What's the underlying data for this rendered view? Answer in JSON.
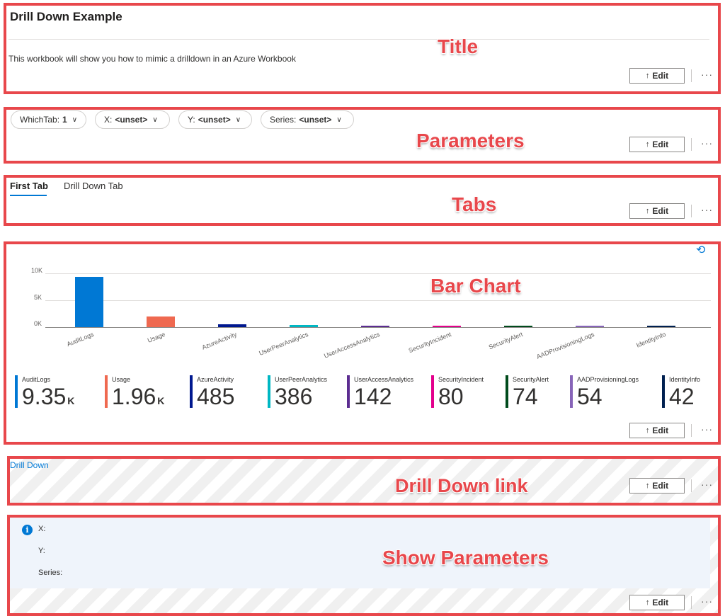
{
  "title_section": {
    "heading": "Drill Down Example",
    "description": "This workbook will show you how to mimic a drilldown in an Azure Workbook",
    "annotation": "Title"
  },
  "parameters": {
    "chips": [
      {
        "label": "WhichTab:",
        "value": "1"
      },
      {
        "label": "X:",
        "value": "<unset>"
      },
      {
        "label": "Y:",
        "value": "<unset>"
      },
      {
        "label": "Series:",
        "value": "<unset>"
      }
    ],
    "annotation": "Parameters"
  },
  "tabs": {
    "items": [
      "First Tab",
      "Drill Down Tab"
    ],
    "active_index": 0,
    "annotation": "Tabs"
  },
  "chart_data": {
    "type": "bar",
    "categories": [
      "AuditLogs",
      "Usage",
      "AzureActivity",
      "UserPeerAnalytics",
      "UserAccessAnalytics",
      "SecurityIncident",
      "SecurityAlert",
      "AADProvisioningLogs",
      "IdentityInfo"
    ],
    "values": [
      9350,
      1960,
      485,
      386,
      142,
      80,
      74,
      54,
      42
    ],
    "colors": [
      "#0078d4",
      "#ef6950",
      "#00188f",
      "#00b7c3",
      "#5c2d91",
      "#e3008c",
      "#004b1c",
      "#8764b8",
      "#002050"
    ],
    "yticks": [
      "10K",
      "5K",
      "0K"
    ],
    "ylim": [
      0,
      10000
    ],
    "grid": true,
    "annotation": "Bar Chart"
  },
  "tiles": [
    {
      "name": "AuditLogs",
      "value": "9.35",
      "unit": "K"
    },
    {
      "name": "Usage",
      "value": "1.96",
      "unit": "K"
    },
    {
      "name": "AzureActivity",
      "value": "485",
      "unit": ""
    },
    {
      "name": "UserPeerAnalytics",
      "value": "386",
      "unit": ""
    },
    {
      "name": "UserAccessAnalytics",
      "value": "142",
      "unit": ""
    },
    {
      "name": "SecurityIncident",
      "value": "80",
      "unit": ""
    },
    {
      "name": "SecurityAlert",
      "value": "74",
      "unit": ""
    },
    {
      "name": "AADProvisioningLogs",
      "value": "54",
      "unit": ""
    },
    {
      "name": "IdentityInfo",
      "value": "42",
      "unit": ""
    }
  ],
  "drill_down": {
    "link": "Drill Down",
    "annotation": "Drill Down link"
  },
  "show_params": {
    "x_label": "X:",
    "y_label": "Y:",
    "series_label": "Series:",
    "annotation": "Show Parameters"
  },
  "common": {
    "edit_label": "Edit",
    "edit_arrow": "↑",
    "more_label": "···",
    "accent_color": "#0078d4",
    "annotation_color": "#e8474b"
  }
}
